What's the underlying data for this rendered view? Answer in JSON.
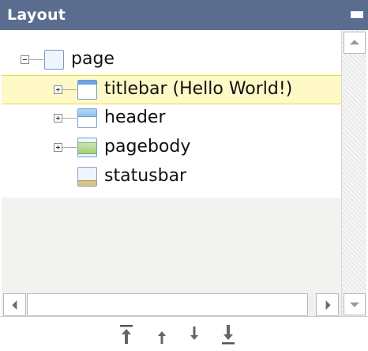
{
  "panel": {
    "title": "Layout"
  },
  "tree": {
    "nodes": [
      {
        "label": "page",
        "icon": "page-icon",
        "expander": "collapse"
      },
      {
        "label": "titlebar (Hello World!)",
        "icon": "titlebar-icon",
        "expander": "expand",
        "selected": true
      },
      {
        "label": "header",
        "icon": "header-icon",
        "expander": "expand"
      },
      {
        "label": "pagebody",
        "icon": "pagebody-icon",
        "expander": "expand"
      },
      {
        "label": "statusbar",
        "icon": "statusbar-icon",
        "expander": "none"
      }
    ]
  },
  "toolbar": {
    "buttons": [
      "move-to-top-icon",
      "move-up-icon",
      "move-down-icon",
      "move-to-bottom-icon"
    ]
  },
  "colors": {
    "titlebar_bg": "#5b6d8e",
    "selection_bg": "#fff9c8",
    "selection_border": "#e9da44"
  }
}
